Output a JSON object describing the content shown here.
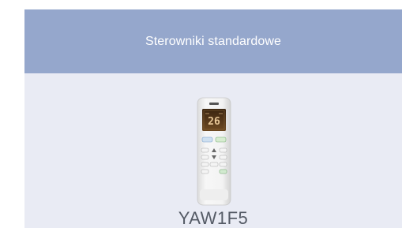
{
  "card": {
    "title": "Sterowniki standardowe",
    "product_name": "YAW1F5",
    "product_image_icon": "remote-control-icon",
    "display_value": "26"
  },
  "colors": {
    "header_bg": "#95a7cc",
    "card_bg": "#e9ebf4",
    "title_text": "#ffffff",
    "name_text": "#555b66"
  }
}
